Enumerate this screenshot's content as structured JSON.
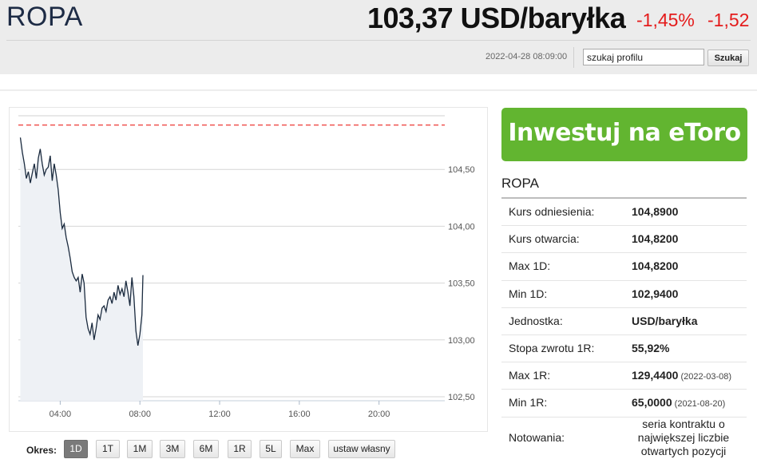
{
  "header": {
    "instrument": "ROPA",
    "price": "103,37 USD/baryłka",
    "change_pct": "-1,45%",
    "change_abs": "-1,52",
    "timestamp": "2022-04-28 08:09:00",
    "search_value": "szukaj profilu",
    "search_button": "Szukaj"
  },
  "colors": {
    "accent_negative": "#e41b1b",
    "etoro_green": "#62b530",
    "chart_line": "#1a2a3e",
    "reference_line": "#ef5350"
  },
  "chart_data": {
    "type": "line",
    "x_tick_labels": [
      "04:00",
      "08:00",
      "12:00",
      "16:00",
      "20:00"
    ],
    "x_tick_hours": [
      4,
      8,
      12,
      16,
      20
    ],
    "y_tick_labels": [
      "104,50",
      "104,00",
      "103,50",
      "103,00",
      "102,50"
    ],
    "y_tick_values": [
      104.5,
      104.0,
      103.5,
      103.0,
      102.5
    ],
    "ylim": [
      102.5,
      105.0
    ],
    "xlim_hours": [
      1.9,
      23.3
    ],
    "reference_value": 104.89,
    "reference_style": "dashed red line",
    "grid": "horizontal",
    "series": [
      {
        "x": [
          2.0,
          2.1,
          2.2,
          2.3,
          2.4,
          2.5,
          2.6,
          2.7,
          2.8,
          2.9,
          3.0,
          3.1,
          3.2,
          3.3,
          3.4,
          3.5,
          3.6,
          3.7,
          3.8,
          3.9,
          4.0,
          4.1,
          4.2,
          4.3,
          4.4,
          4.5,
          4.6,
          4.7,
          4.8,
          4.9,
          5.0,
          5.1,
          5.2,
          5.3,
          5.4,
          5.5,
          5.6,
          5.7,
          5.8,
          5.9,
          6.0,
          6.1,
          6.2,
          6.3,
          6.4,
          6.5,
          6.6,
          6.7,
          6.8,
          6.9,
          7.0,
          7.1,
          7.2,
          7.3,
          7.4,
          7.5,
          7.6,
          7.7,
          7.8,
          7.9,
          8.0,
          8.1,
          8.15
        ],
        "y": [
          104.78,
          104.65,
          104.55,
          104.42,
          104.48,
          104.38,
          104.47,
          104.55,
          104.42,
          104.6,
          104.68,
          104.55,
          104.45,
          104.5,
          104.52,
          104.62,
          104.4,
          104.55,
          104.45,
          104.32,
          104.12,
          103.98,
          104.02,
          103.9,
          103.82,
          103.72,
          103.6,
          103.55,
          103.52,
          103.55,
          103.42,
          103.58,
          103.5,
          103.2,
          103.1,
          103.05,
          103.15,
          103.0,
          103.1,
          103.22,
          103.18,
          103.28,
          103.3,
          103.25,
          103.35,
          103.38,
          103.32,
          103.42,
          103.35,
          103.48,
          103.4,
          103.45,
          103.38,
          103.52,
          103.42,
          103.3,
          103.55,
          103.38,
          103.08,
          102.95,
          103.05,
          103.22,
          103.57
        ]
      }
    ]
  },
  "range": {
    "label": "Okres:",
    "buttons": [
      "1D",
      "1T",
      "1M",
      "3M",
      "6M",
      "1R",
      "5L",
      "Max",
      "ustaw własny"
    ]
  },
  "cta": {
    "label": "Inwestuj na eToro"
  },
  "side": {
    "title": "ROPA",
    "rows": [
      {
        "label": "Kurs odniesienia:",
        "value": "104,8900",
        "date": ""
      },
      {
        "label": "Kurs otwarcia:",
        "value": "104,8200",
        "date": ""
      },
      {
        "label": "Max 1D:",
        "value": "104,8200",
        "date": ""
      },
      {
        "label": "Min 1D:",
        "value": "102,9400",
        "date": ""
      },
      {
        "label": "Jednostka:",
        "value": "USD/baryłka",
        "date": ""
      },
      {
        "label": "Stopa zwrotu 1R:",
        "value": "55,92%",
        "date": ""
      },
      {
        "label": "Max 1R:",
        "value": "129,4400",
        "date": "(2022-03-08)"
      },
      {
        "label": "Min 1R:",
        "value": "65,0000",
        "date": "(2021-08-20)"
      }
    ],
    "notowania_label": "Notowania:",
    "notowania_value": "seria kontraktu o największej liczbie otwartych pozycji"
  }
}
